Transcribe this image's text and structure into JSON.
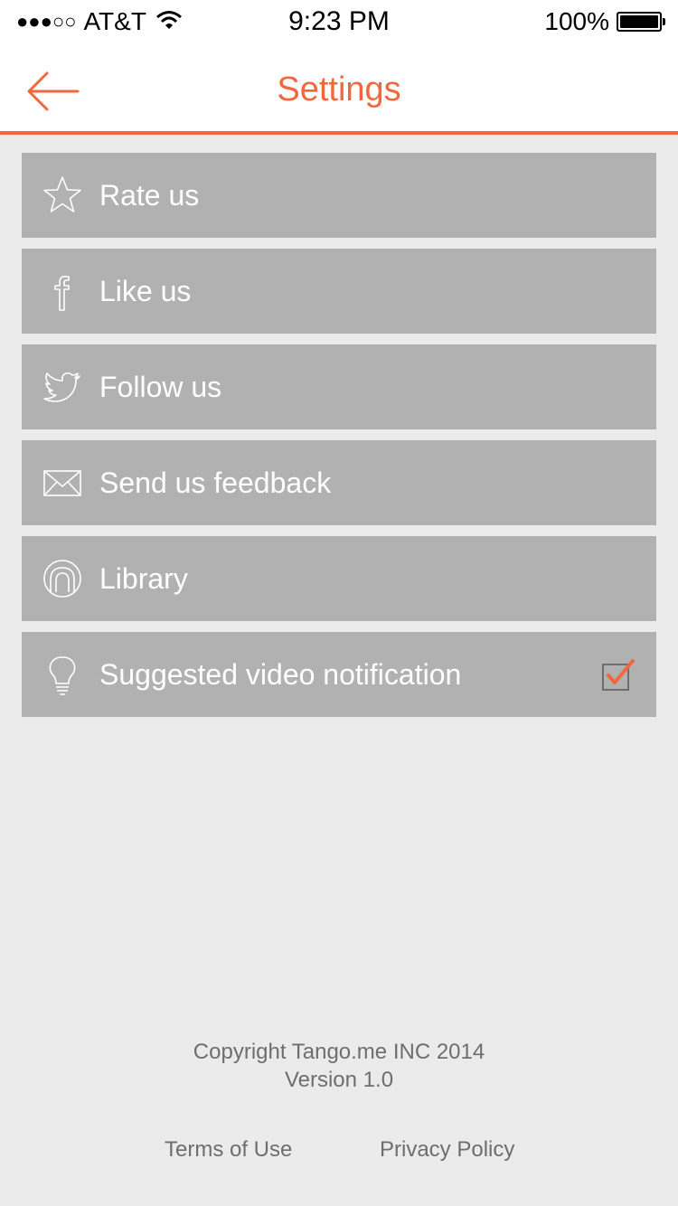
{
  "status_bar": {
    "signal": "●●●○○",
    "carrier": "AT&T",
    "time": "9:23 PM",
    "battery": "100%",
    "battery_level": 1.0
  },
  "nav": {
    "title": "Settings",
    "back_icon": "arrow-left-icon",
    "accent_color": "#f2683c"
  },
  "menu": [
    {
      "label": "Rate us",
      "icon": "star-icon"
    },
    {
      "label": "Like us",
      "icon": "facebook-icon"
    },
    {
      "label": "Follow us",
      "icon": "twitter-icon"
    },
    {
      "label": "Send us feedback",
      "icon": "envelope-icon"
    },
    {
      "label": "Library",
      "icon": "library-icon"
    },
    {
      "label": "Suggested video notification",
      "icon": "lightbulb-icon",
      "checked": true
    }
  ],
  "footer": {
    "copyright": "Copyright Tango.me INC 2014",
    "version": "Version 1.0",
    "terms": "Terms of Use",
    "privacy": "Privacy Policy"
  }
}
